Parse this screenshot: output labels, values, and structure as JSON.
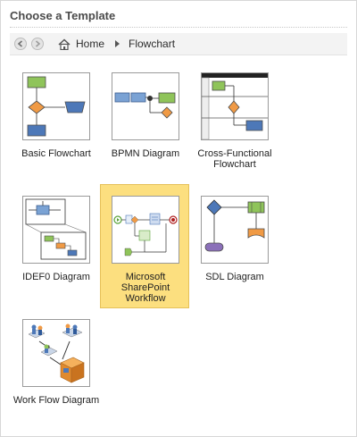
{
  "dialog": {
    "title": "Choose a Template"
  },
  "breadcrumb": {
    "home": "Home",
    "current": "Flowchart"
  },
  "templates": [
    {
      "label_lines": [
        "Basic Flowchart"
      ],
      "selected": false
    },
    {
      "label_lines": [
        "BPMN Diagram"
      ],
      "selected": false
    },
    {
      "label_lines": [
        "Cross-Functional",
        "Flowchart"
      ],
      "selected": false
    },
    {
      "label_lines": [
        "IDEF0 Diagram"
      ],
      "selected": false
    },
    {
      "label_lines": [
        "Microsoft",
        "SharePoint",
        "Workflow"
      ],
      "selected": true
    },
    {
      "label_lines": [
        "SDL Diagram"
      ],
      "selected": false
    },
    {
      "label_lines": [
        "Work Flow Diagram"
      ],
      "selected": false
    }
  ],
  "colors": {
    "selection_fill": "#fcdf7f",
    "shape_green": "#8fc45a",
    "shape_orange": "#f09a45",
    "shape_blue": "#4d78b8",
    "shape_purple": "#8b70b9"
  }
}
